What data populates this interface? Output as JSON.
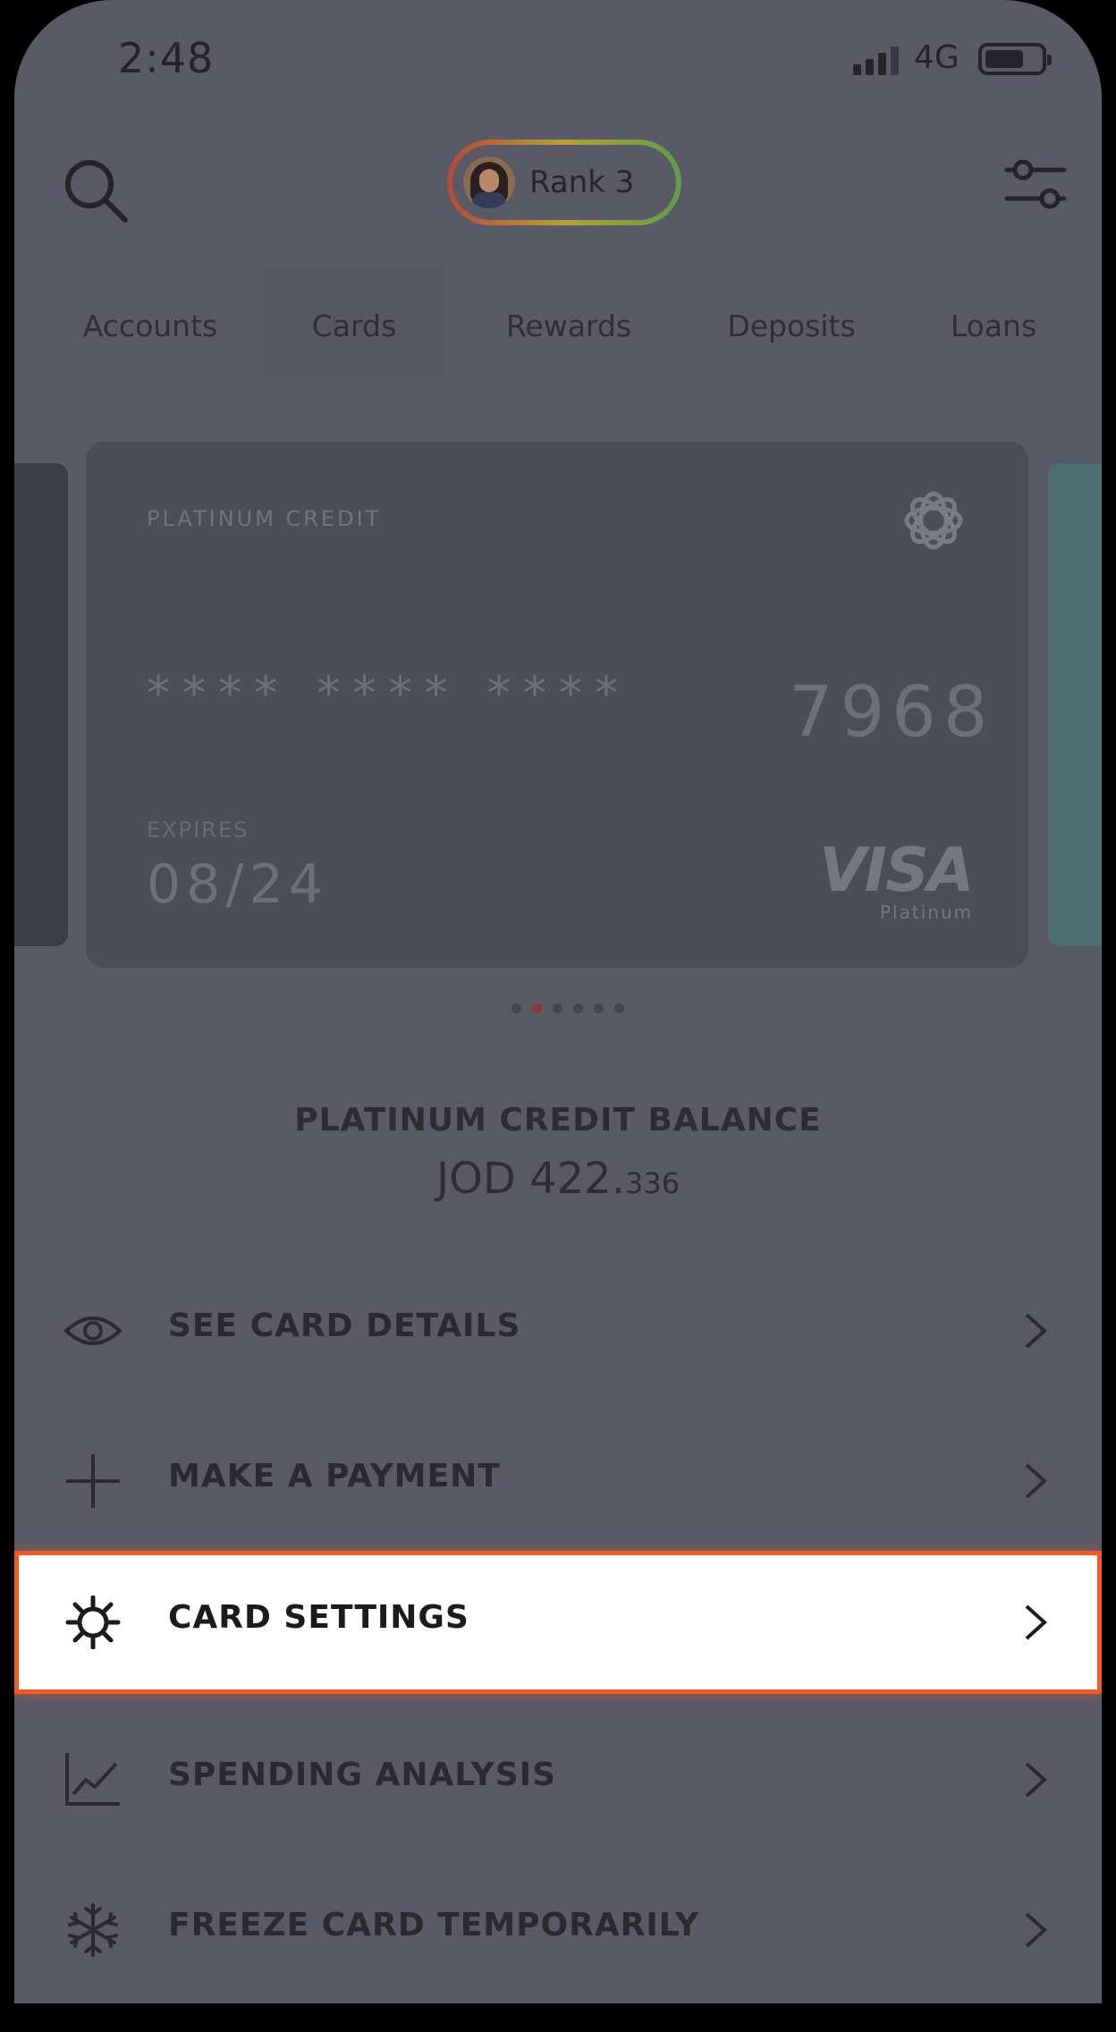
{
  "status_bar": {
    "time": "2:48",
    "network": "4G"
  },
  "header": {
    "rank_label": "Rank 3"
  },
  "tabs": [
    {
      "label": "Accounts",
      "active": false
    },
    {
      "label": "Cards",
      "active": true
    },
    {
      "label": "Rewards",
      "active": false
    },
    {
      "label": "Deposits",
      "active": false
    },
    {
      "label": "Loans",
      "active": false
    }
  ],
  "card": {
    "type": "PLATINUM CREDIT",
    "masked": "**** **** ****",
    "last4": "7968",
    "expires_label": "EXPIRES",
    "expires": "08/24",
    "brand": "VISA",
    "brand_sub": "Platinum"
  },
  "carousel": {
    "pages": 6,
    "active_index": 1
  },
  "balance": {
    "title": "PLATINUM CREDIT BALANCE",
    "amount_main": "JOD 422.",
    "amount_decimal": "336"
  },
  "menu": [
    {
      "label": "SEE CARD DETAILS",
      "icon": "eye-icon"
    },
    {
      "label": "MAKE A PAYMENT",
      "icon": "plus-icon"
    },
    {
      "label": "CARD SETTINGS",
      "icon": "gear-icon",
      "highlighted": true
    },
    {
      "label": "SPENDING ANALYSIS",
      "icon": "chart-icon"
    },
    {
      "label": "FREEZE CARD TEMPORARILY",
      "icon": "snowflake-icon"
    }
  ],
  "colors": {
    "highlight_border": "#f05a24",
    "screen_dim": "#595a66"
  }
}
